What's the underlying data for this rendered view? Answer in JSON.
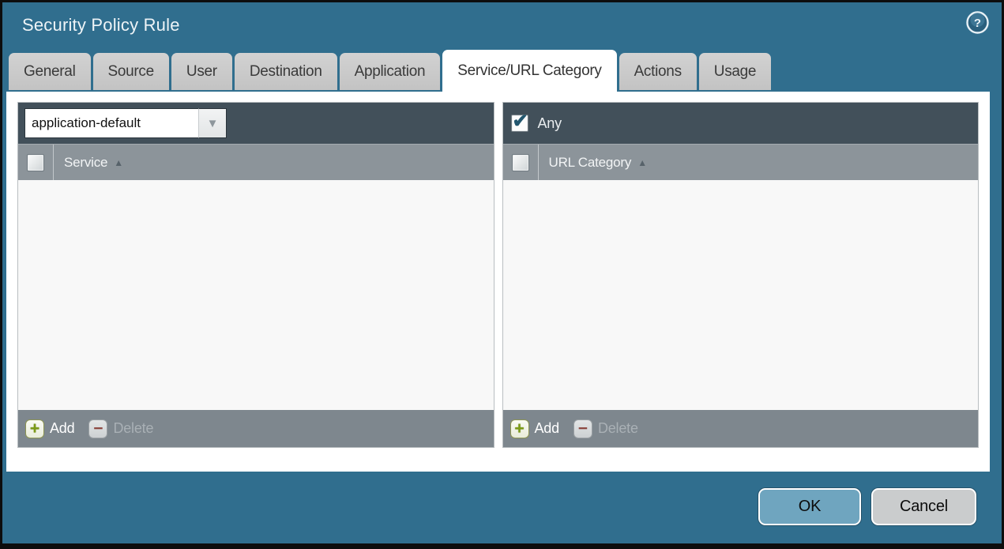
{
  "window": {
    "title": "Security Policy Rule"
  },
  "tabs": [
    {
      "label": "General",
      "active": false
    },
    {
      "label": "Source",
      "active": false
    },
    {
      "label": "User",
      "active": false
    },
    {
      "label": "Destination",
      "active": false
    },
    {
      "label": "Application",
      "active": false
    },
    {
      "label": "Service/URL Category",
      "active": true
    },
    {
      "label": "Actions",
      "active": false
    },
    {
      "label": "Usage",
      "active": false
    }
  ],
  "service_panel": {
    "dropdown_value": "application-default",
    "dropdown_arrow": "▼",
    "column_header": "Service",
    "sort_arrow": "▲",
    "checkbox_checked": false,
    "rows": [],
    "add_label": "Add",
    "delete_label": "Delete",
    "delete_enabled": false
  },
  "url_category_panel": {
    "any_label": "Any",
    "any_checked": true,
    "column_header": "URL Category",
    "sort_arrow": "▲",
    "checkbox_checked": false,
    "rows": [],
    "add_label": "Add",
    "delete_label": "Delete",
    "delete_enabled": false
  },
  "actions": {
    "ok_label": "OK",
    "cancel_label": "Cancel"
  },
  "icons": {
    "help": "question-mark",
    "add": "+",
    "delete": "−"
  },
  "colors": {
    "dialog_background": "#306e8e",
    "panel_header_dark": "#42505a",
    "column_header_gray": "#8c949a",
    "footer_gray": "#7e878e",
    "ok_button": "#6fa5bf",
    "cancel_button": "#cacccd",
    "add_plus_green": "#7c9b16",
    "delete_minus_red": "#8e4a43",
    "checkmark": "#23576f"
  }
}
